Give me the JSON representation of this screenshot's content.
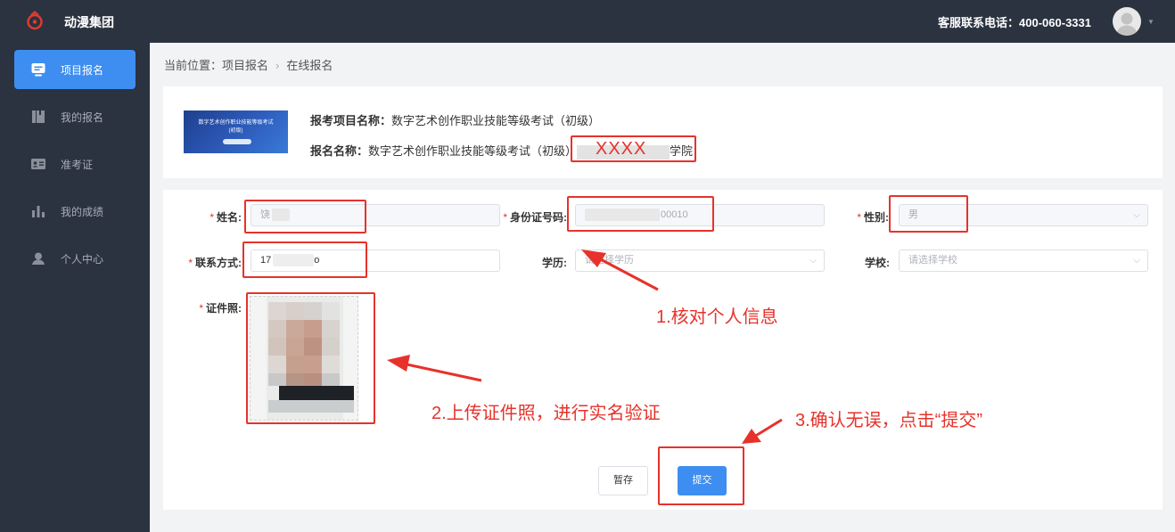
{
  "header": {
    "brand": "动漫集团",
    "hotline": "客服联系电话：400-060-3331"
  },
  "sidebar": {
    "items": [
      {
        "label": "项目报名",
        "icon": "signup-icon"
      },
      {
        "label": "我的报名",
        "icon": "book-icon"
      },
      {
        "label": "准考证",
        "icon": "id-card-icon"
      },
      {
        "label": "我的成绩",
        "icon": "bar-chart-icon"
      },
      {
        "label": "个人中心",
        "icon": "user-icon"
      }
    ]
  },
  "breadcrumb": {
    "prefix": "当前位置：项目报名",
    "current": "在线报名"
  },
  "project": {
    "cover_title": "数字艺术创作职业技能等级考试",
    "cover_sub": "(初级)",
    "name_label": "报考项目名称：",
    "name_value": "数字艺术创作职业技能等级考试（初级）",
    "signup_label": "报名名称：",
    "signup_value_prefix": "数字艺术创作职业技能等级考试（初级）",
    "signup_value_suffix": "学院",
    "redacted_mark": "XXXX"
  },
  "form": {
    "name_label": "姓名:",
    "name_value": "饶",
    "idcard_label": "身份证号码:",
    "idcard_value": "00010",
    "gender_label": "性别:",
    "gender_value": "男",
    "phone_label": "联系方式:",
    "phone_prefix": "17",
    "phone_suffix": "o",
    "education_label": "学历:",
    "education_value": "请选择学历",
    "school_label": "学校:",
    "school_placeholder": "请选择学校",
    "photo_label": "证件照:"
  },
  "buttons": {
    "save": "暂存",
    "submit": "提交"
  },
  "annotations": {
    "step1": "1.核对个人信息",
    "step2": "2.上传证件照，进行实名验证",
    "step3": "3.确认无误，点击“提交”"
  },
  "colors": {
    "sidebar_bg": "#2b3240",
    "accent": "#3d8ef0",
    "annotation_red": "#e6322b"
  }
}
